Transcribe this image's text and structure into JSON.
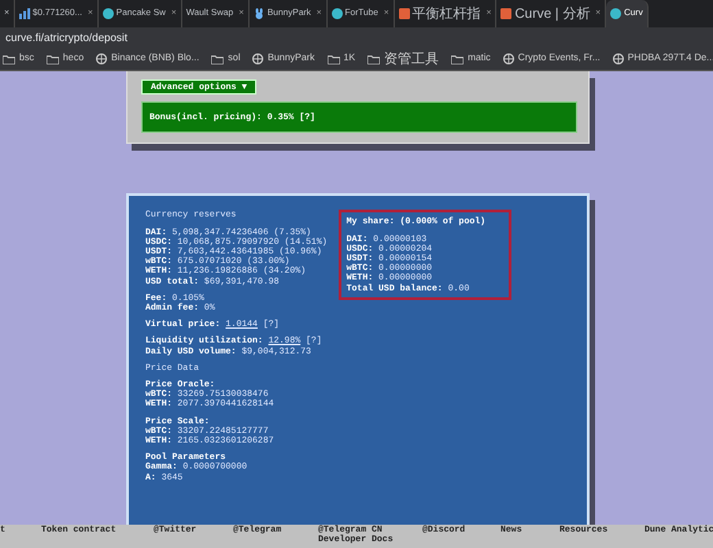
{
  "browser": {
    "tabs": [
      {
        "title": "×",
        "selected": false,
        "kind": "plain"
      },
      {
        "title": "$0.771260...",
        "close": "×",
        "selected": false,
        "kind": "chart"
      },
      {
        "title": "Pancake Sw",
        "close": "×",
        "selected": false,
        "kind": "round"
      },
      {
        "title": "Wault Swap",
        "close": "×",
        "selected": false,
        "kind": "plain"
      },
      {
        "title": "BunnyPark",
        "close": "×",
        "selected": false,
        "kind": "bunny"
      },
      {
        "title": "ForTube",
        "close": "×",
        "selected": false,
        "kind": "round"
      },
      {
        "title": "平衡杠杆指",
        "close": "×",
        "selected": false,
        "kind": "square"
      },
      {
        "title": "Curve | 分析",
        "close": "×",
        "selected": false,
        "kind": "square"
      },
      {
        "title": "Curv",
        "selected": true,
        "kind": "round"
      }
    ],
    "address": "curve.fi/atricrypto/deposit",
    "bookmarks": [
      {
        "label": "bsc",
        "kind": "folder"
      },
      {
        "label": "heco",
        "kind": "folder"
      },
      {
        "label": "Binance (BNB) Blo...",
        "kind": "site"
      },
      {
        "label": "sol",
        "kind": "folder"
      },
      {
        "label": "BunnyPark",
        "kind": "site"
      },
      {
        "label": "1K",
        "kind": "folder"
      },
      {
        "label": "资管工具",
        "kind": "folder"
      },
      {
        "label": "matic",
        "kind": "folder"
      },
      {
        "label": "Crypto Events, Fr...",
        "kind": "site"
      },
      {
        "label": "PHDBA 297T.4 De...",
        "kind": "site"
      }
    ]
  },
  "deposit": {
    "advanced_options": {
      "label": "Advanced options",
      "caret": "▼"
    },
    "bonus": "Bonus(incl. pricing): 0.35% [?]"
  },
  "reserves": {
    "heading": "Currency reserves",
    "groups": [
      [
        {
          "label": "DAI:",
          "value": "5,098,347.74236406 (7.35%)"
        },
        {
          "label": "USDC:",
          "value": "10,068,875.79097920 (14.51%)"
        },
        {
          "label": "USDT:",
          "value": "7,603,442.43641985 (10.96%)"
        },
        {
          "label": "wBTC:",
          "value": "675.07071020 (33.00%)"
        },
        {
          "label": "WETH:",
          "value": "11,236.19826886 (34.20%)"
        },
        {
          "label": "USD total:",
          "value": "$69,391,470.98"
        }
      ],
      [
        {
          "label": "Fee:",
          "value": "0.105%"
        },
        {
          "label": "Admin fee:",
          "value": "0%"
        }
      ],
      [
        {
          "label": "Virtual price:",
          "value": "1.0144",
          "note": "[?]"
        }
      ],
      [
        {
          "label": "Liquidity utilization:",
          "value": "12.98%",
          "note": "[?]"
        },
        {
          "label": "Daily USD volume:",
          "value": "$9,004,312.73"
        }
      ]
    ],
    "price_heading": "Price Data",
    "price_groups": [
      {
        "title": "Price Oracle:",
        "lines": [
          {
            "label": "wBTC:",
            "value": "33269.75130038476"
          },
          {
            "label": "WETH:",
            "value": "2077.3970441628144"
          }
        ]
      },
      {
        "title": "Price Scale:",
        "lines": [
          {
            "label": "wBTC:",
            "value": "33207.22485127777"
          },
          {
            "label": "WETH:",
            "value": "2165.0323601206287"
          }
        ]
      },
      {
        "title": "Pool Parameters",
        "lines": [
          {
            "label": "Gamma:",
            "value": "0.0000700000"
          },
          {
            "label": "A:",
            "value": "3645"
          }
        ]
      }
    ]
  },
  "my_share": {
    "heading": "My share: (0.000% of pool)",
    "lines": [
      {
        "label": "DAI:",
        "value": "0.00000103"
      },
      {
        "label": "USDC:",
        "value": "0.00000204"
      },
      {
        "label": "USDT:",
        "value": "0.00000154"
      },
      {
        "label": "wBTC:",
        "value": "0.00000000"
      },
      {
        "label": "WETH:",
        "value": "0.00000000"
      },
      {
        "label": "Total USD balance:",
        "value": "0.00"
      }
    ]
  },
  "footer": [
    [
      "t"
    ],
    [
      "Token contract"
    ],
    [
      "@Twitter"
    ],
    [
      "@Telegram"
    ],
    [
      "@Telegram CN",
      "Developer Docs"
    ],
    [
      "@Discord"
    ],
    [
      "News"
    ],
    [
      "Resources"
    ],
    [
      "Dune Analytic"
    ]
  ]
}
